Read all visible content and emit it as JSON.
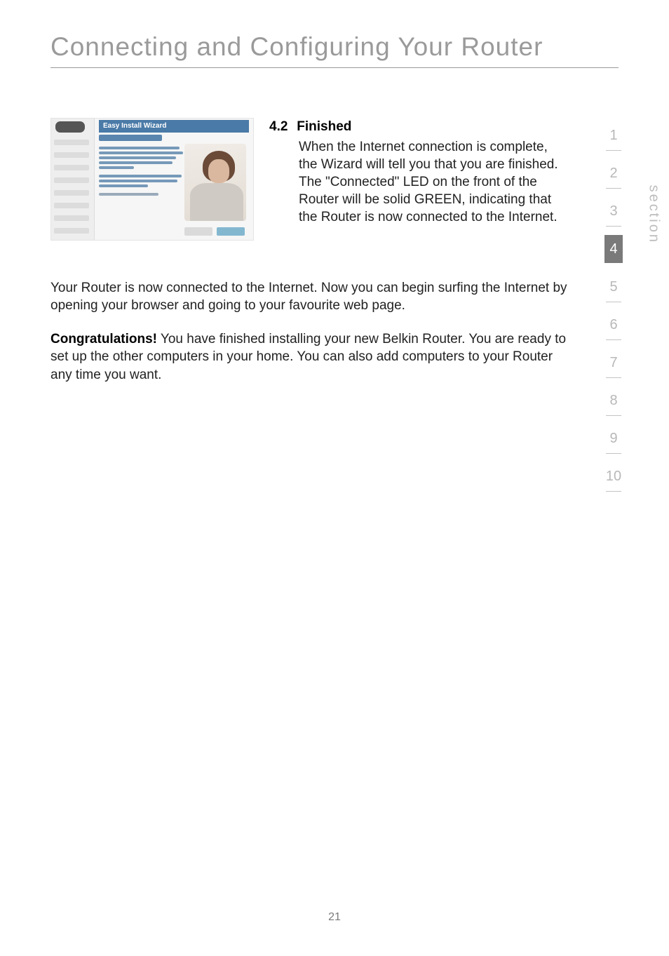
{
  "page": {
    "title": "Connecting and Configuring Your Router",
    "number": "21"
  },
  "step": {
    "number": "4.2",
    "title": "Finished",
    "body": "When the Internet connection is complete, the Wizard will tell you that you are finished. The \"Connected\" LED on the front of the Router will be solid GREEN, indicating that the Router is now connected to the Internet."
  },
  "wizard": {
    "banner": "Easy Install Wizard"
  },
  "para1": "Your Router is now connected to the Internet. Now you can begin surfing the Internet by opening your browser and going to your favourite web page.",
  "para2_bold": "Congratulations!",
  "para2_rest": " You have finished installing your new Belkin Router. You are ready to set up the other computers in your home. You can also add computers to your Router any time you want.",
  "sectionNav": {
    "label": "section",
    "items": [
      "1",
      "2",
      "3",
      "4",
      "5",
      "6",
      "7",
      "8",
      "9",
      "10"
    ],
    "current": "4"
  }
}
